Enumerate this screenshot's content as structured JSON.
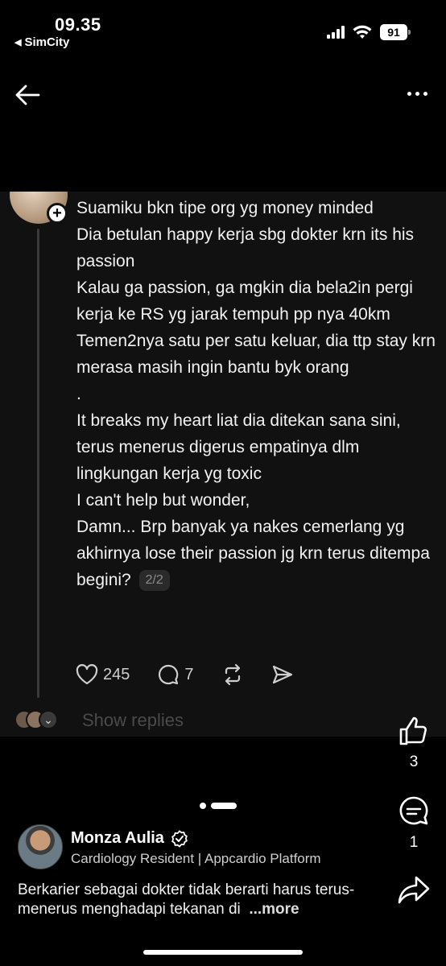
{
  "status_bar": {
    "time": "09.35",
    "back_app": "SimCity",
    "battery": "91"
  },
  "post_screenshot": {
    "lines": [
      "Suamiku bkn tipe org yg money minded",
      "Dia betulan happy kerja sbg dokter krn its his passion",
      "Kalau ga passion, ga mgkin dia bela2in pergi kerja ke RS yg jarak tempuh pp nya 40km",
      "Temen2nya satu per satu keluar, dia ttp stay krn merasa masih ingin bantu byk orang",
      ".",
      "It breaks my heart liat dia ditekan sana sini, terus menerus digerus empatinya dlm lingkungan kerja yg toxic",
      "I can't help but wonder,",
      "Damn... Brp banyak ya nakes cemerlang yg akhirnya lose their passion jg krn terus ditempa begini?"
    ],
    "page_badge": "2/2",
    "likes": "245",
    "comments": "7",
    "show_replies": "Show replies"
  },
  "rail": {
    "likes": "3",
    "comments": "1"
  },
  "author": {
    "name": "Monza Aulia",
    "subtitle": "Cardiology Resident | Appcardio Platform"
  },
  "caption": {
    "text": "Berkarier sebagai dokter tidak berarti harus terus-menerus menghadapi tekanan di",
    "more": "...more"
  },
  "colors": {
    "background": "#000000",
    "card": "#111111",
    "muted": "#4a4a4a"
  }
}
